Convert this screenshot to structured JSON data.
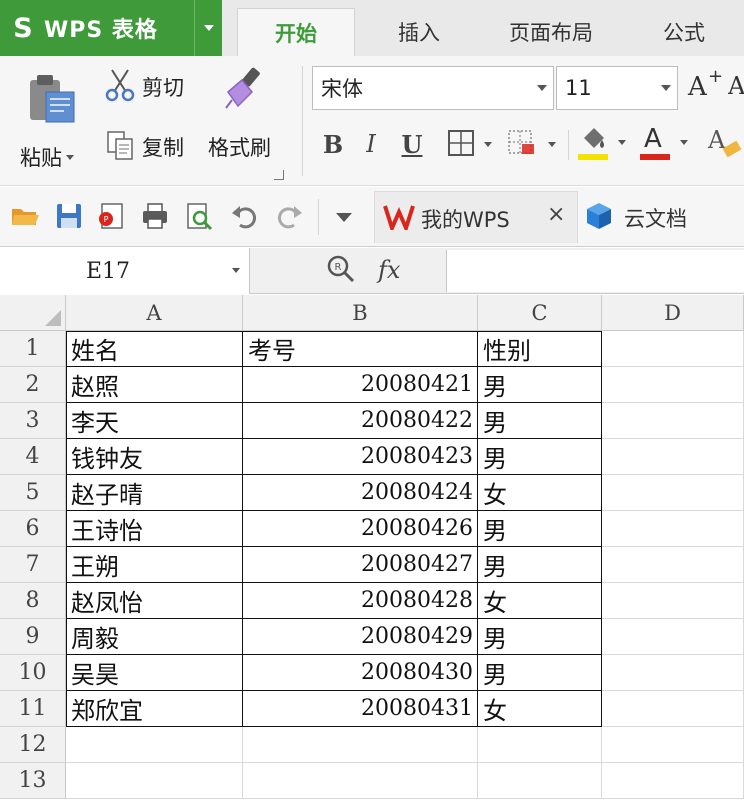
{
  "app": {
    "title": "WPS 表格"
  },
  "tabs": [
    {
      "label": "开始",
      "active": true
    },
    {
      "label": "插入",
      "active": false
    },
    {
      "label": "页面布局",
      "active": false
    },
    {
      "label": "公式",
      "active": false
    }
  ],
  "ribbon": {
    "paste_label": "粘贴",
    "cut_label": "剪切",
    "copy_label": "复制",
    "format_painter_label": "格式刷",
    "font_name": "宋体",
    "font_size": "11",
    "bold": "B",
    "italic": "I",
    "underline": "U"
  },
  "quick_access": {
    "my_wps_label": "我的WPS",
    "cloud_docs_label": "云文档"
  },
  "formula_bar": {
    "cell_ref": "E17",
    "fx_label": "fx",
    "formula_value": ""
  },
  "colors": {
    "brand": "#3f9b3a",
    "ribbon_bg": "#f6f6f6",
    "header_bg": "#f1f1f1",
    "font_color_bar": "#d9261c",
    "highlight_bar": "#f2e400",
    "wps_red": "#d9261c",
    "cloud_blue": "#2a7fd6"
  },
  "sheet": {
    "columns": [
      "A",
      "B",
      "C",
      "D"
    ],
    "rows": [
      "1",
      "2",
      "3",
      "4",
      "5",
      "6",
      "7",
      "8",
      "9",
      "10",
      "11",
      "12",
      "13"
    ],
    "cells": [
      [
        "姓名",
        "考号",
        "性别"
      ],
      [
        "赵照",
        "20080421",
        "男"
      ],
      [
        "李天",
        "20080422",
        "男"
      ],
      [
        "钱钟友",
        "20080423",
        "男"
      ],
      [
        "赵子晴",
        "20080424",
        "女"
      ],
      [
        "王诗怡",
        "20080426",
        "男"
      ],
      [
        "王朔",
        "20080427",
        "男"
      ],
      [
        "赵凤怡",
        "20080428",
        "女"
      ],
      [
        "周毅",
        "20080429",
        "男"
      ],
      [
        "吴昊",
        "20080430",
        "男"
      ],
      [
        "郑欣宜",
        "20080431",
        "女"
      ]
    ]
  }
}
